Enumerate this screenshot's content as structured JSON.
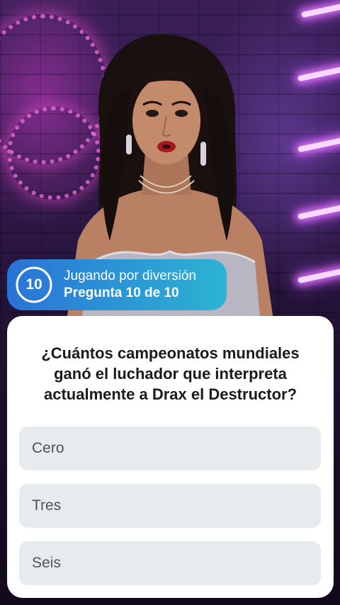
{
  "progress": {
    "current_number": "10",
    "mode_label": "Jugando por diversión",
    "question_counter": "Pregunta 10 de 10",
    "fraction_complete": 1.0
  },
  "question": {
    "text": "¿Cuántos campeonatos mundiales ganó el luchador que interpreta actualmente a Drax el Destructor?"
  },
  "answers": [
    {
      "label": "Cero"
    },
    {
      "label": "Tres"
    },
    {
      "label": "Seis"
    }
  ],
  "colors": {
    "chip_gradient_start": "#2a72d6",
    "chip_gradient_end": "#2cb4d2",
    "card_background": "#ffffff",
    "answer_background": "#e8ebee",
    "answer_text": "#4e5358",
    "question_text": "#1b1b1b"
  },
  "background_media": {
    "description_icon": "video-host-frame"
  }
}
